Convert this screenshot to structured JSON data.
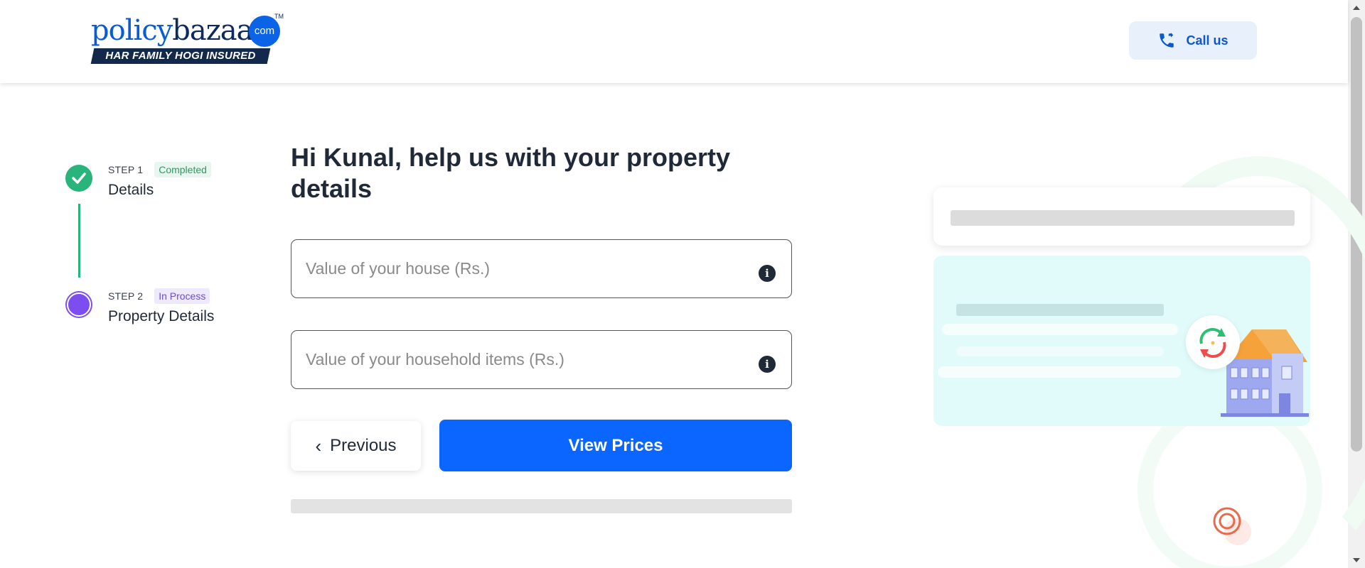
{
  "brand": {
    "logo_part1": "policy",
    "logo_part2": "bazaar",
    "logo_com": "com",
    "logo_tm": "TM",
    "tagline": "HAR FAMILY HOGI INSURED"
  },
  "header": {
    "call_label": "Call us",
    "call_icon": "phone-transfer-icon"
  },
  "steps": [
    {
      "number": "STEP 1",
      "status": "Completed",
      "title": "Details",
      "state_color": "#28b47a"
    },
    {
      "number": "STEP 2",
      "status": "In Process",
      "title": "Property Details",
      "state_color": "#7c4ef0"
    }
  ],
  "form": {
    "heading": "Hi Kunal, help us with your property details",
    "house_value": {
      "placeholder": "Value of your house (Rs.)",
      "value": ""
    },
    "household_value": {
      "placeholder": "Value of your household items (Rs.)",
      "value": ""
    },
    "info_glyph": "i",
    "previous_label": "Previous",
    "view_prices_label": "View Prices"
  },
  "colors": {
    "primary": "#0a66ff",
    "brand_blue": "#0a5bd6",
    "brand_navy": "#13294b",
    "success": "#28b47a",
    "in_process": "#7c4ef0"
  }
}
